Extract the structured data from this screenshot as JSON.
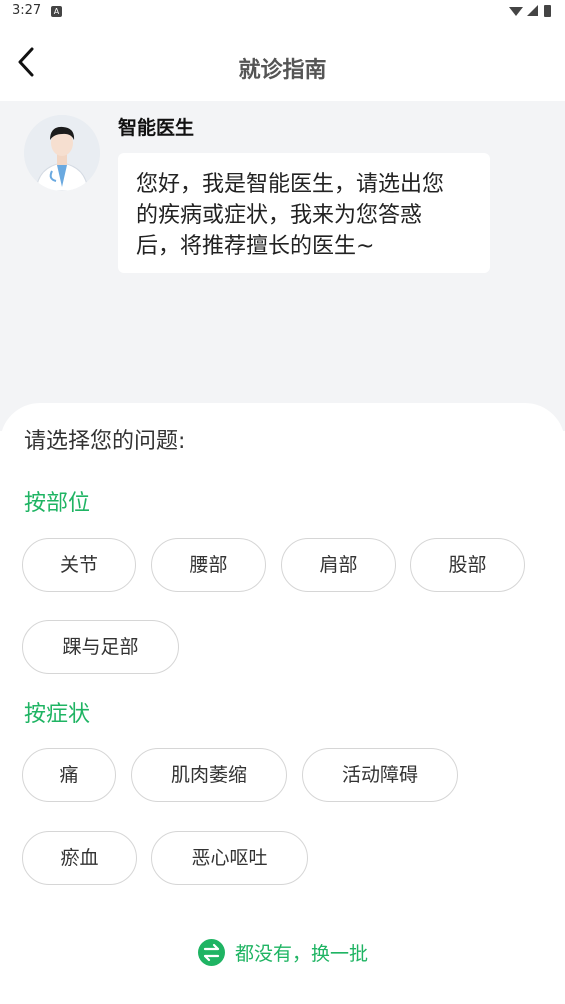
{
  "status_bar": {
    "time": "3:27",
    "notif_letter": "A"
  },
  "header": {
    "title": "就诊指南"
  },
  "chat": {
    "bot_name": "智能医生",
    "message_lines": [
      "您好，我是智能医生，请选出您",
      "的疾病或症状，我来为您答惑",
      "后，将推荐擅长的医生~"
    ]
  },
  "panel": {
    "prompt": "请选择您的问题:",
    "by_body": {
      "title": "按部位",
      "items": [
        "关节",
        "腰部",
        "肩部",
        "股部",
        "踝与足部"
      ]
    },
    "by_symptom": {
      "title": "按症状",
      "items": [
        "痛",
        "肌肉萎缩",
        "活动障碍",
        "瘀血",
        "恶心呕吐"
      ]
    },
    "refresh_label": "都没有，换一批"
  },
  "colors": {
    "accent": "#1fb463",
    "chat_bg": "#f3f4f6"
  }
}
